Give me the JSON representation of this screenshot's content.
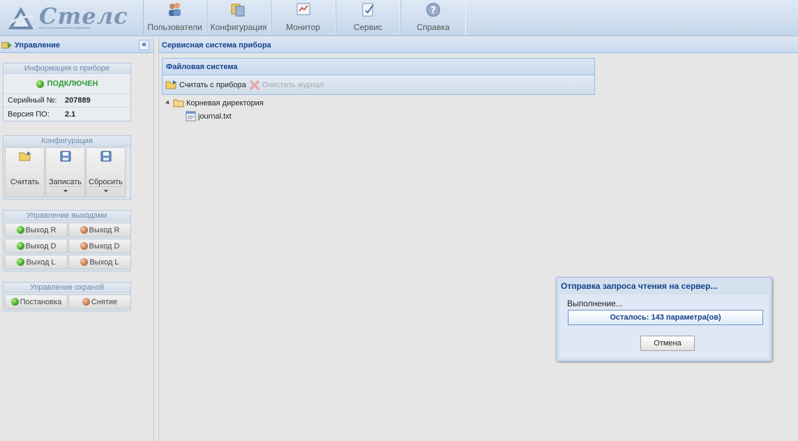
{
  "header": {
    "logo_text": "Стелс",
    "logo_subtext": "научно-производственное предприятие",
    "nav": [
      {
        "label": "Пользователи",
        "icon": "users-icon"
      },
      {
        "label": "Конфигурация",
        "icon": "configuration-icon"
      },
      {
        "label": "Монитор",
        "icon": "monitor-icon"
      },
      {
        "label": "Сервис",
        "icon": "service-icon"
      },
      {
        "label": "Справка",
        "icon": "help-icon"
      }
    ]
  },
  "left_panel": {
    "title": "Управление",
    "collapse_symbol": "«",
    "device_info": {
      "title": "Информация о приборе",
      "status": "ПОДКЛЮЧЕН",
      "serial_label": "Серийный №:",
      "serial_value": "207889",
      "version_label": "Версия ПО:",
      "version_value": "2.1"
    },
    "configuration": {
      "title": "Конфигурация",
      "read_label": "Считать",
      "write_label": "Записать",
      "reset_label": "Сбросить"
    },
    "outputs": {
      "title": "Управление выходами",
      "rows": [
        {
          "on": "Выход R",
          "off": "Выход R"
        },
        {
          "on": "Выход D",
          "off": "Выход D"
        },
        {
          "on": "Выход L",
          "off": "Выход L"
        }
      ]
    },
    "security": {
      "title": "Управление охраной",
      "arm_label": "Постановка",
      "disarm_label": "Снятие"
    }
  },
  "main": {
    "title": "Сервисная система прибора",
    "file_system": {
      "title": "Файловая система",
      "read_button": "Считать с прибора",
      "clear_button": "Очистить журнал",
      "root_label": "Корневая директория",
      "files": [
        "journal.txt"
      ]
    }
  },
  "dialog": {
    "title": "Отправка запроса чтения на сервер...",
    "message": "Выполнение...",
    "progress_text": "Осталось: 143 параметра(ов)",
    "progress_fraction": 0,
    "cancel_label": "Отмена"
  },
  "colors": {
    "accent": "#15428b",
    "status_green": "#2f9a35",
    "panel_border": "#99bbe8"
  }
}
